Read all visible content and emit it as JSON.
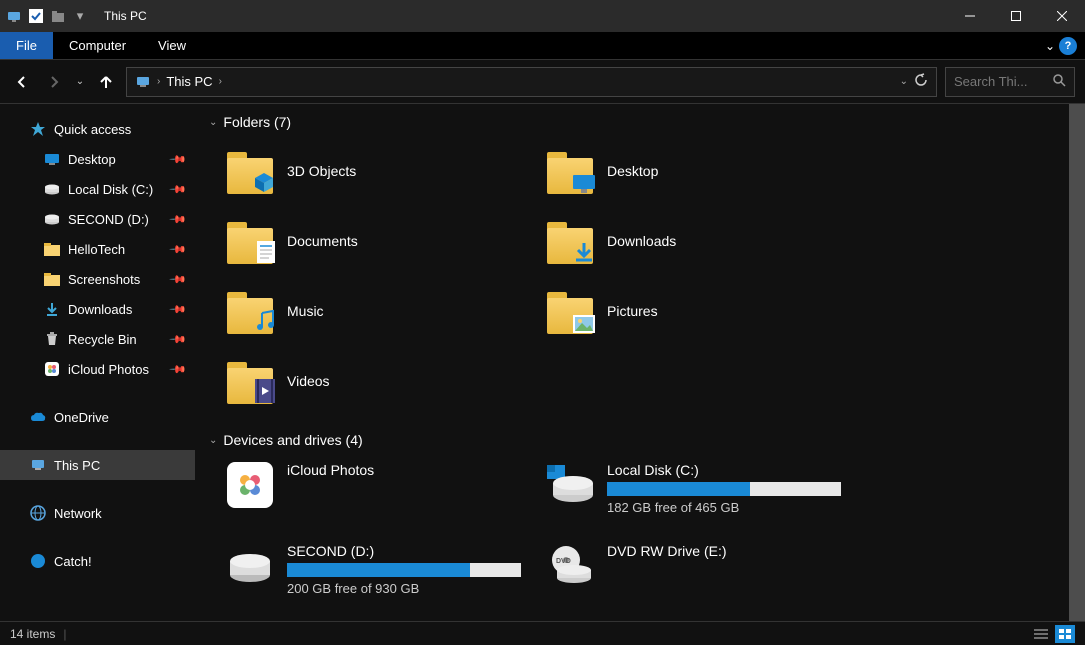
{
  "title": "This PC",
  "ribbon": {
    "tabs": [
      "File",
      "Computer",
      "View"
    ]
  },
  "nav": {
    "breadcrumb_icon": "this-pc",
    "breadcrumb": [
      "This PC"
    ],
    "search_placeholder": "Search Thi..."
  },
  "sidebar": {
    "quick_access": "Quick access",
    "items": [
      {
        "label": "Desktop",
        "pinned": true,
        "icon": "desktop"
      },
      {
        "label": "Local Disk (C:)",
        "pinned": true,
        "icon": "drive"
      },
      {
        "label": "SECOND (D:)",
        "pinned": true,
        "icon": "drive"
      },
      {
        "label": "HelloTech",
        "pinned": true,
        "icon": "folder"
      },
      {
        "label": "Screenshots",
        "pinned": true,
        "icon": "folder"
      },
      {
        "label": "Downloads",
        "pinned": true,
        "icon": "downloads"
      },
      {
        "label": "Recycle Bin",
        "pinned": true,
        "icon": "recycle"
      },
      {
        "label": "iCloud Photos",
        "pinned": true,
        "icon": "icloud"
      }
    ],
    "onedrive": "OneDrive",
    "this_pc": "This PC",
    "network": "Network",
    "catch": "Catch!"
  },
  "main": {
    "folders_header": "Folders (7)",
    "folders": [
      {
        "label": "3D Objects"
      },
      {
        "label": "Desktop"
      },
      {
        "label": "Documents"
      },
      {
        "label": "Downloads"
      },
      {
        "label": "Music"
      },
      {
        "label": "Pictures"
      },
      {
        "label": "Videos"
      }
    ],
    "drives_header": "Devices and drives (4)",
    "drives": [
      {
        "label": "iCloud Photos",
        "type": "icloud",
        "bar": false
      },
      {
        "label": "Local Disk (C:)",
        "type": "disk-os",
        "bar": true,
        "fill_pct": 61,
        "subtext": "182 GB free of 465 GB"
      },
      {
        "label": "SECOND (D:)",
        "type": "disk",
        "bar": true,
        "fill_pct": 78,
        "subtext": "200 GB free of 930 GB"
      },
      {
        "label": "DVD RW Drive (E:)",
        "type": "dvd",
        "bar": false
      }
    ]
  },
  "status": {
    "count": "14 items"
  }
}
